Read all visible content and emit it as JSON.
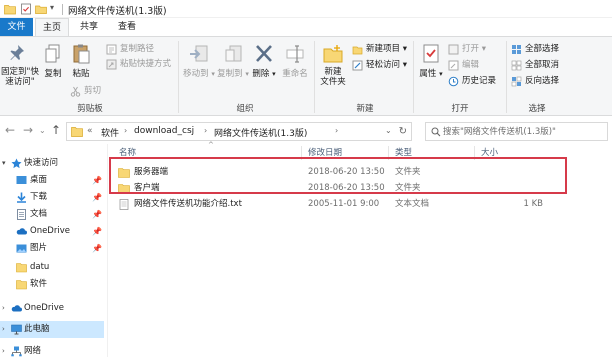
{
  "window": {
    "title": "网络文件传送机(1.3版)"
  },
  "tabs": [
    {
      "label": "文件"
    },
    {
      "label": "主页"
    },
    {
      "label": "共享"
    },
    {
      "label": "查看"
    }
  ],
  "ribbon": {
    "clipboard": {
      "pin_label": "固定到\"快速访问\"",
      "copy_label": "复制",
      "paste_label": "粘贴",
      "copy_path_label": "复制路径",
      "paste_shortcut_label": "粘贴快捷方式",
      "cut_label": "剪切",
      "group_label": "剪贴板"
    },
    "organize": {
      "move_to_label": "移动到",
      "copy_to_label": "复制到",
      "delete_label": "删除",
      "rename_label": "重命名",
      "group_label": "组织"
    },
    "new": {
      "new_folder_label": "新建\n文件夹",
      "new_item_label": "新建项目 ▾",
      "easy_access_label": "轻松访问 ▾",
      "group_label": "新建"
    },
    "open": {
      "properties_label": "属性",
      "open_label": "打开 ▾",
      "edit_label": "编辑",
      "history_label": "历史记录",
      "group_label": "打开"
    },
    "select": {
      "select_all_label": "全部选择",
      "select_none_label": "全部取消",
      "invert_label": "反向选择",
      "group_label": "选择"
    }
  },
  "address": {
    "crumbs": [
      "软件",
      "download_csj",
      "网络文件传送机(1.3版)"
    ],
    "overflow": "«",
    "search_placeholder": "搜索\"网络文件传送机(1.3版)\""
  },
  "nav": {
    "items": [
      {
        "label": "快速访问",
        "icon": "star-icon"
      },
      {
        "label": "桌面",
        "icon": "desktop-icon",
        "pinned": "📌"
      },
      {
        "label": "下载",
        "icon": "download-icon",
        "pinned": "📌"
      },
      {
        "label": "文档",
        "icon": "document-icon",
        "pinned": "📌"
      },
      {
        "label": "OneDrive",
        "icon": "cloud-icon",
        "pinned": "📌"
      },
      {
        "label": "图片",
        "icon": "picture-icon",
        "pinned": "📌"
      },
      {
        "label": "datu",
        "icon": "folder-icon"
      },
      {
        "label": "软件",
        "icon": "folder-icon"
      },
      {
        "label": "OneDrive",
        "icon": "cloud-icon"
      },
      {
        "label": "此电脑",
        "icon": "computer-icon"
      },
      {
        "label": "网络",
        "icon": "network-icon"
      }
    ]
  },
  "files": {
    "columns": [
      "名称",
      "修改日期",
      "类型",
      "大小"
    ],
    "rows": [
      {
        "name": "服务器端",
        "date": "2018-06-20 13:50",
        "type": "文件夹",
        "size": "",
        "kind": "folder"
      },
      {
        "name": "客户端",
        "date": "2018-06-20 13:50",
        "type": "文件夹",
        "size": "",
        "kind": "folder"
      },
      {
        "name": "网络文件传送机功能介绍.txt",
        "date": "2005-11-01 9:00",
        "type": "文本文档",
        "size": "1 KB",
        "kind": "text"
      }
    ]
  },
  "colors": {
    "file_tab": "#1979ca",
    "selection": "#cce8ff",
    "highlight_box": "#d63a4a",
    "folder": "#f8d775"
  }
}
